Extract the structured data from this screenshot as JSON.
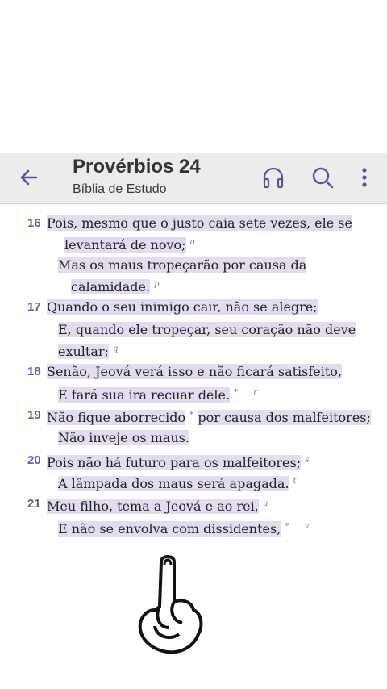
{
  "header": {
    "title": "Provérbios 24",
    "subtitle": "Bíblia de Estudo"
  },
  "verses": [
    {
      "num": "16",
      "lines": [
        "Pois, mesmo que o justo caia sete vezes, ele se",
        "levantará de novo;",
        "Mas os maus tropeçarão por causa da",
        "calamidade."
      ],
      "marks": [
        "o",
        "p"
      ]
    },
    {
      "num": "17",
      "lines": [
        "Quando o seu inimigo cair, não se alegre;",
        "E, quando ele tropeçar, seu coração não deve",
        "exultar;"
      ],
      "marks": [
        "q"
      ]
    },
    {
      "num": "18",
      "lines": [
        "Senão, Jeová verá isso e não ficará satisfeito,",
        "E fará sua ira recuar dele."
      ],
      "marks": [
        "*",
        "r"
      ]
    },
    {
      "num": "19",
      "lines": [
        "Não fique aborrecido",
        "por causa dos malfeitores;",
        "Não inveje os maus."
      ],
      "marks": [
        "*"
      ]
    },
    {
      "num": "20",
      "lines": [
        "Pois não há futuro para os malfeitores;",
        "A lâmpada dos maus será apagada."
      ],
      "marks": [
        "s",
        "t"
      ]
    },
    {
      "num": "21",
      "lines": [
        "Meu filho, tema a Jeová e ao rei,",
        "E não se envolva com dissidentes,"
      ],
      "marks": [
        "u",
        "*",
        "v"
      ]
    }
  ],
  "icons": {
    "back": "arrow-left-icon",
    "audio": "headphones-icon",
    "search": "search-icon",
    "menu": "more-vertical-icon"
  },
  "colors": {
    "accent": "#5e4f9a",
    "highlight": "#e3dcf1",
    "header_bg": "#ececec"
  }
}
